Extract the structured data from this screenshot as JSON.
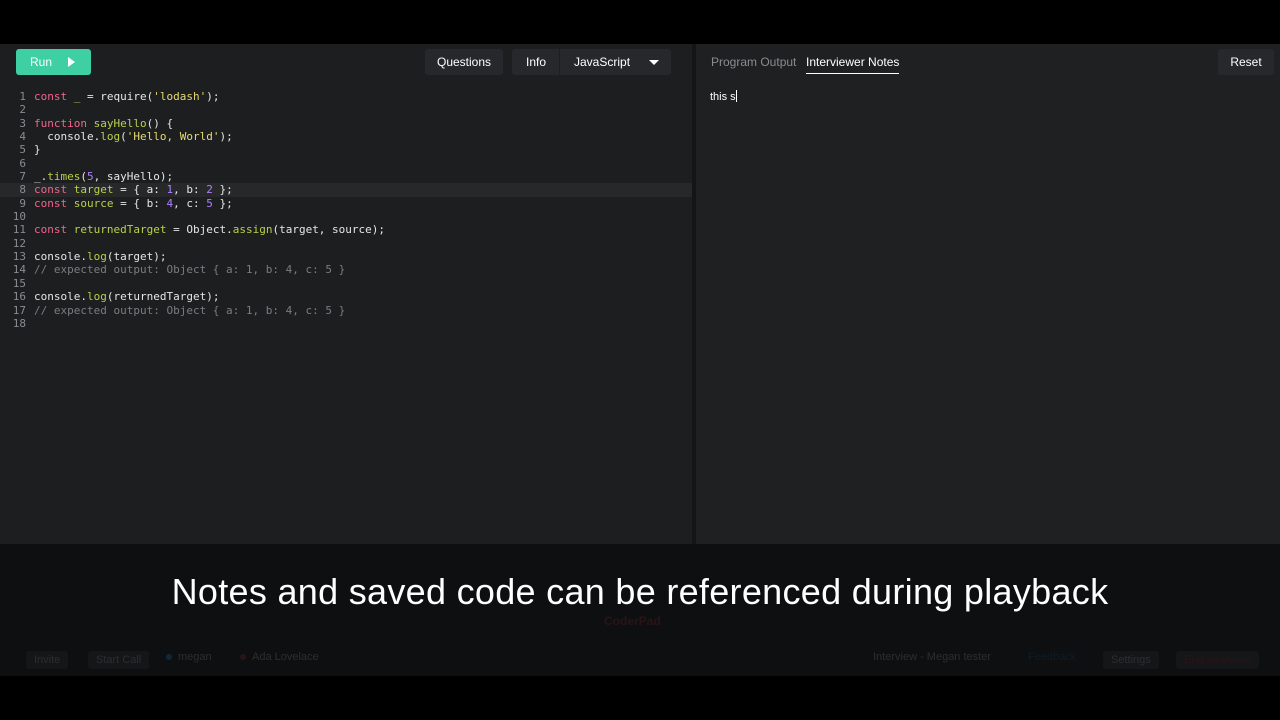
{
  "toolbar": {
    "run_label": "Run",
    "questions_label": "Questions",
    "info_label": "Info",
    "language": "JavaScript"
  },
  "editor": {
    "active_line": 8,
    "lines": [
      {
        "n": "1"
      },
      {
        "n": "2"
      },
      {
        "n": "3"
      },
      {
        "n": "4"
      },
      {
        "n": "5"
      },
      {
        "n": "6"
      },
      {
        "n": "7"
      },
      {
        "n": "8"
      },
      {
        "n": "9"
      },
      {
        "n": "10"
      },
      {
        "n": "11"
      },
      {
        "n": "12"
      },
      {
        "n": "13"
      },
      {
        "n": "14"
      },
      {
        "n": "15"
      },
      {
        "n": "16"
      },
      {
        "n": "17"
      },
      {
        "n": "18"
      }
    ],
    "code": {
      "l1": [
        "const",
        " ",
        "_",
        " = require(",
        "'lodash'",
        ");"
      ],
      "l3": [
        "function",
        " ",
        "sayHello",
        "() {"
      ],
      "l4": [
        "  console.",
        "log",
        "(",
        "'Hello, World'",
        ");"
      ],
      "l5": [
        "}"
      ],
      "l7": [
        "_.",
        "times",
        "(",
        "5",
        ", sayHello);"
      ],
      "l8": [
        "const",
        " ",
        "target",
        " = { a: ",
        "1",
        ", b: ",
        "2",
        " };"
      ],
      "l9": [
        "const",
        " ",
        "source",
        " = { b: ",
        "4",
        ", c: ",
        "5",
        " };"
      ],
      "l11": [
        "const",
        " ",
        "returnedTarget",
        " = Object.",
        "assign",
        "(target, source);"
      ],
      "l13": [
        "console.",
        "log",
        "(target);"
      ],
      "l14": [
        "// expected output: Object { a: 1, b: 4, c: 5 }"
      ],
      "l16": [
        "console.",
        "log",
        "(returnedTarget);"
      ],
      "l17": [
        "// expected output: Object { a: 1, b: 4, c: 5 }"
      ]
    }
  },
  "output_panel": {
    "tab_output": "Program Output",
    "tab_notes": "Interviewer Notes",
    "reset_label": "Reset",
    "notes_text": "this s"
  },
  "bottombar": {
    "invite": "Invite",
    "start_call": "Start Call",
    "user1": "megan",
    "user2": "Ada Lovelace",
    "logo": "CoderPad",
    "interview_title": "Interview - Megan tester",
    "feedback": "Feedback",
    "settings": "Settings",
    "end_interview": "End Interview"
  },
  "caption": "Notes and saved code can be referenced during playback",
  "colors": {
    "run_button": "#3ecfa2",
    "keyword": "#f2648c",
    "function": "#b8d24a",
    "string": "#e6db74",
    "number": "#ae81ff",
    "comment": "#7a7d80"
  }
}
